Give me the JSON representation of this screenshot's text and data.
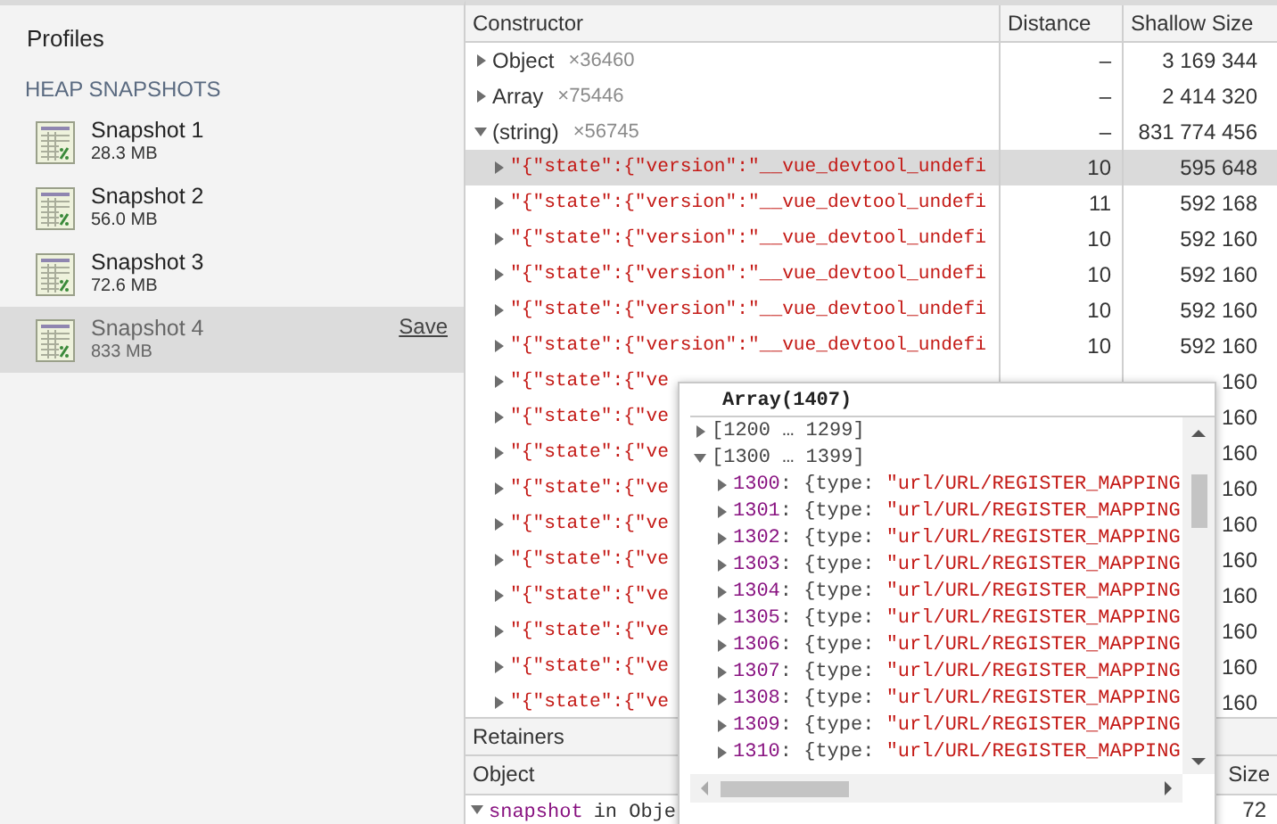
{
  "sidebar": {
    "title": "Profiles",
    "section": "HEAP SNAPSHOTS",
    "items": [
      {
        "name": "Snapshot 1",
        "size": "28.3 MB",
        "selected": false
      },
      {
        "name": "Snapshot 2",
        "size": "56.0 MB",
        "selected": false
      },
      {
        "name": "Snapshot 3",
        "size": "72.6 MB",
        "selected": false
      },
      {
        "name": "Snapshot 4",
        "size": "833 MB",
        "selected": true,
        "action": "Save"
      }
    ]
  },
  "table": {
    "columns": [
      "Constructor",
      "Distance",
      "Shallow Size"
    ],
    "rows": [
      {
        "name": "Object",
        "count": "×36460",
        "distance": "–",
        "shallow": "3 169 344",
        "expanded": false
      },
      {
        "name": "Array",
        "count": "×75446",
        "distance": "–",
        "shallow": "2 414 320",
        "expanded": false
      },
      {
        "name": "(string)",
        "count": "×56745",
        "distance": "–",
        "shallow": "831 774 456",
        "expanded": true,
        "children": [
          {
            "text": "\"{\"state\":{\"version\":\"__vue_devtool_undefi",
            "distance": "10",
            "shallow": "595 648",
            "selected": true
          },
          {
            "text": "\"{\"state\":{\"version\":\"__vue_devtool_undefi",
            "distance": "11",
            "shallow": "592 168",
            "selected": false
          },
          {
            "text": "\"{\"state\":{\"version\":\"__vue_devtool_undefi",
            "distance": "10",
            "shallow": "592 160",
            "selected": false
          },
          {
            "text": "\"{\"state\":{\"version\":\"__vue_devtool_undefi",
            "distance": "10",
            "shallow": "592 160",
            "selected": false
          },
          {
            "text": "\"{\"state\":{\"version\":\"__vue_devtool_undefi",
            "distance": "10",
            "shallow": "592 160",
            "selected": false
          },
          {
            "text": "\"{\"state\":{\"version\":\"__vue_devtool_undefi",
            "distance": "10",
            "shallow": "592 160",
            "selected": false
          },
          {
            "text": "\"{\"state\":{\"ve",
            "shallow": "160",
            "selected": false
          },
          {
            "text": "\"{\"state\":{\"ve",
            "shallow": "160",
            "selected": false
          },
          {
            "text": "\"{\"state\":{\"ve",
            "shallow": "160",
            "selected": false
          },
          {
            "text": "\"{\"state\":{\"ve",
            "shallow": "160",
            "selected": false
          },
          {
            "text": "\"{\"state\":{\"ve",
            "shallow": "160",
            "selected": false
          },
          {
            "text": "\"{\"state\":{\"ve",
            "shallow": "160",
            "selected": false
          },
          {
            "text": "\"{\"state\":{\"ve",
            "shallow": "160",
            "selected": false
          },
          {
            "text": "\"{\"state\":{\"ve",
            "shallow": "160",
            "selected": false
          },
          {
            "text": "\"{\"state\":{\"ve",
            "shallow": "160",
            "selected": false
          },
          {
            "text": "\"{\"state\":{\"ve",
            "shallow": "160",
            "selected": false
          }
        ]
      }
    ]
  },
  "retainers": {
    "title": "Retainers",
    "columns": [
      "Object",
      "Size"
    ],
    "rows": [
      {
        "name": "snapshot",
        "rest": "in Obje",
        "size": "72",
        "expanded": true
      }
    ]
  },
  "popup": {
    "title": "Array(1407)",
    "groups": [
      {
        "label": "[1200 … 1299]",
        "expanded": false
      },
      {
        "label": "[1300 … 1399]",
        "expanded": true,
        "children": [
          {
            "index": "1300",
            "value": ": {type: ",
            "str": "\"url/URL/REGISTER_MAPPING"
          },
          {
            "index": "1301",
            "value": ": {type: ",
            "str": "\"url/URL/REGISTER_MAPPING"
          },
          {
            "index": "1302",
            "value": ": {type: ",
            "str": "\"url/URL/REGISTER_MAPPING"
          },
          {
            "index": "1303",
            "value": ": {type: ",
            "str": "\"url/URL/REGISTER_MAPPING"
          },
          {
            "index": "1304",
            "value": ": {type: ",
            "str": "\"url/URL/REGISTER_MAPPING"
          },
          {
            "index": "1305",
            "value": ": {type: ",
            "str": "\"url/URL/REGISTER_MAPPING"
          },
          {
            "index": "1306",
            "value": ": {type: ",
            "str": "\"url/URL/REGISTER_MAPPING"
          },
          {
            "index": "1307",
            "value": ": {type: ",
            "str": "\"url/URL/REGISTER_MAPPING"
          },
          {
            "index": "1308",
            "value": ": {type: ",
            "str": "\"url/URL/REGISTER_MAPPING"
          },
          {
            "index": "1309",
            "value": ": {type: ",
            "str": "\"url/URL/REGISTER_MAPPING"
          },
          {
            "index": "1310",
            "value": ": {type: ",
            "str": "\"url/URL/REGISTER_MAPPING"
          }
        ]
      }
    ]
  }
}
